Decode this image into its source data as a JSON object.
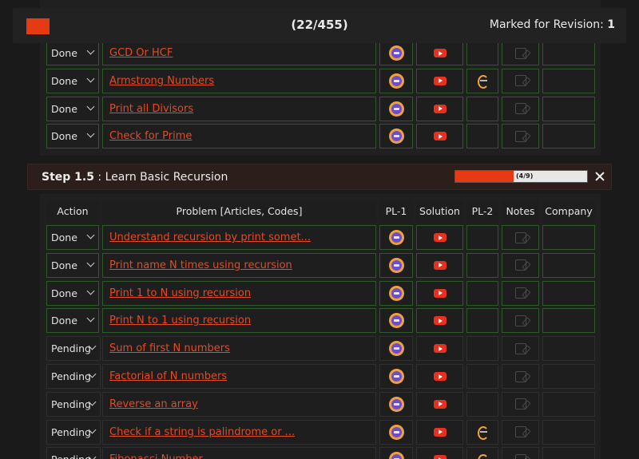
{
  "topbar": {
    "count": "(22/455)",
    "revision_label": "Marked for Revision:",
    "revision_count": "1"
  },
  "section1": {
    "rows": [
      {
        "action": "Done",
        "problem": "GCD Or HCF",
        "pl2": false
      },
      {
        "action": "Done",
        "problem": "Armstrong Numbers",
        "pl2": true
      },
      {
        "action": "Done",
        "problem": "Print all Divisors",
        "pl2": false
      },
      {
        "action": "Done",
        "problem": "Check for Prime",
        "pl2": false
      }
    ]
  },
  "step": {
    "label": "Step 1.5",
    "separator": " : ",
    "title": "Learn Basic Recursion",
    "progress_text": "(4/9)",
    "progress": 0.444
  },
  "table": {
    "headers": {
      "action": "Action",
      "problem": "Problem [Articles, Codes]",
      "pl1": "PL-1",
      "solution": "Solution",
      "pl2": "PL-2",
      "notes": "Notes",
      "company": "Company"
    },
    "rows": [
      {
        "action": "Done",
        "problem": "Understand recursion by print somet...",
        "pl2": false
      },
      {
        "action": "Done",
        "problem": "Print name N times using recursion",
        "pl2": false
      },
      {
        "action": "Done",
        "problem": "Print 1 to N using recursion",
        "pl2": false
      },
      {
        "action": "Done",
        "problem": "Print N to 1 using recursion",
        "pl2": false
      },
      {
        "action": "Pending",
        "problem": "Sum of first N numbers",
        "pl2": false
      },
      {
        "action": "Pending",
        "problem": "Factorial of N numbers",
        "pl2": false
      },
      {
        "action": "Pending",
        "problem": "Reverse an array",
        "pl2": false
      },
      {
        "action": "Pending",
        "problem": "Check if a string is palindrome or ...",
        "pl2": true
      },
      {
        "action": "Pending",
        "problem": "Fibonacci Number",
        "pl2": true
      }
    ]
  },
  "icons": {
    "pl1": "codestudio-icon",
    "solution": "youtube-icon",
    "pl2": "leetcode-icon",
    "notes": "note-edit-icon",
    "close": "close-icon"
  },
  "colors": {
    "accent": "#e63a12",
    "link": "#e64a24",
    "done_border": "#2e5a2a"
  }
}
